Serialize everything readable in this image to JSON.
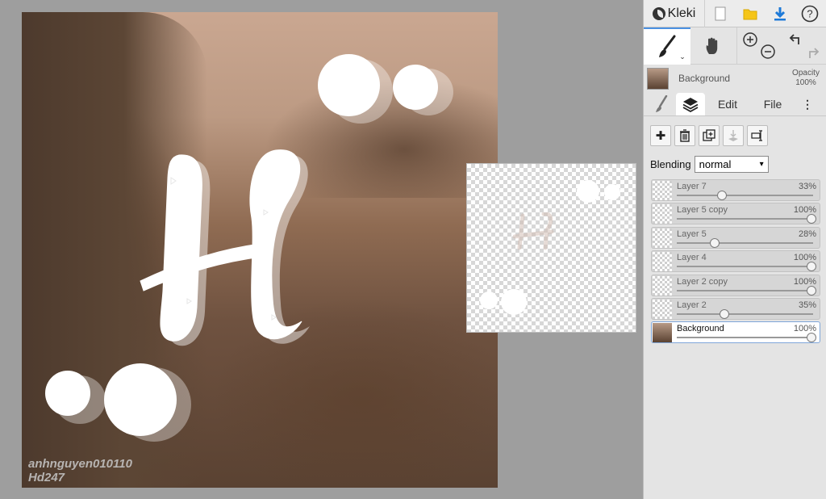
{
  "app": {
    "name": "Kleki"
  },
  "canvas": {
    "watermark_line1": "anhnguyen010110",
    "watermark_line2": "Hd247"
  },
  "toolbar": {
    "new_icon": "new-file-icon",
    "open_icon": "folder-icon",
    "save_icon": "download-icon",
    "help_icon": "help-icon"
  },
  "current_layer": {
    "name": "Background",
    "opacity_label": "Opacity",
    "opacity_value": "100%"
  },
  "tabs": {
    "edit": "Edit",
    "file": "File"
  },
  "blending": {
    "label": "Blending",
    "value": "normal"
  },
  "layers": [
    {
      "name": "Layer 7",
      "opacity": "33%",
      "level": 0.33,
      "active": false
    },
    {
      "name": "Layer 5 copy",
      "opacity": "100%",
      "level": 1.0,
      "active": false
    },
    {
      "name": "Layer 5",
      "opacity": "28%",
      "level": 0.28,
      "active": false
    },
    {
      "name": "Layer 4",
      "opacity": "100%",
      "level": 1.0,
      "active": false
    },
    {
      "name": "Layer 2 copy",
      "opacity": "100%",
      "level": 1.0,
      "active": false
    },
    {
      "name": "Layer 2",
      "opacity": "35%",
      "level": 0.35,
      "active": false
    },
    {
      "name": "Background",
      "opacity": "100%",
      "level": 1.0,
      "active": true
    }
  ],
  "colors": {
    "accent": "#4a90e2",
    "panel_bg": "#e4e4e4",
    "workspace_bg": "#9e9e9e"
  }
}
